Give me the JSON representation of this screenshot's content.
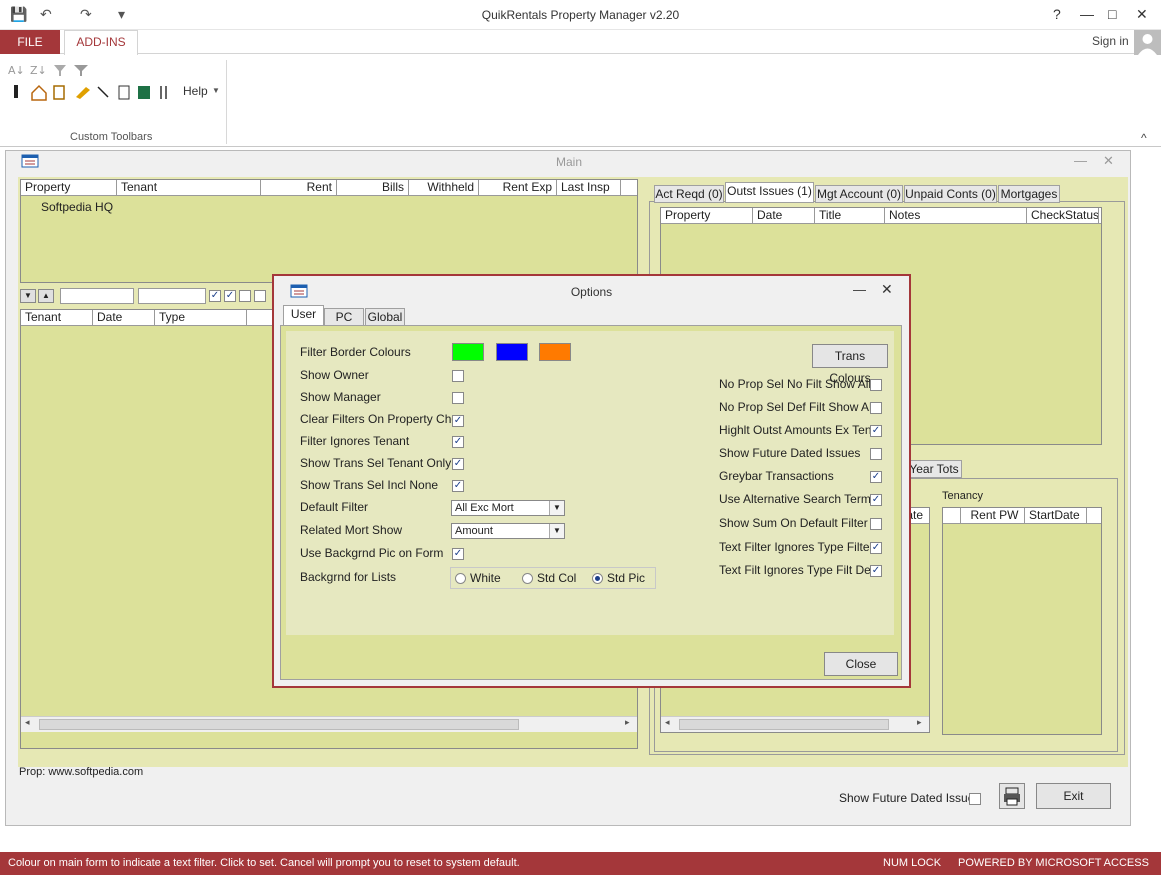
{
  "window": {
    "title": "QuikRentals Property Manager  v2.20",
    "help": "?",
    "min": "—",
    "max": "□",
    "close": "✕"
  },
  "quick_access": {
    "save": "💾",
    "undo": "↶",
    "redo": "↷",
    "more": "▾"
  },
  "ribbon": {
    "tabs": {
      "file": "FILE",
      "addins": "ADD-INS"
    },
    "signin": "Sign in",
    "help_label": "Help",
    "group_label": "Custom Toolbars",
    "collapse": "^"
  },
  "main": {
    "title": "Main",
    "property_list": {
      "headers": [
        "Property",
        "Tenant",
        "Rent",
        "Bills",
        "Withheld",
        "Rent Exp",
        "Last Insp"
      ],
      "rows": [
        [
          "Softpedia HQ",
          "",
          "",
          "",
          "",
          "",
          ""
        ]
      ]
    },
    "trans_list": {
      "headers": [
        "Tenant",
        "Date",
        "Type"
      ]
    },
    "prop_text": "Prop: www.softpedia.com",
    "right_tabs": [
      "Act Reqd (0)",
      "Outst Issues (1)",
      "Mgt Account (0)",
      "Unpaid Conts (0)",
      "Mortgages"
    ],
    "issues_headers": [
      "Property",
      "Date",
      "Title",
      "Notes",
      "CheckStatus"
    ],
    "lower_tab": "Year Tots",
    "tenancy_label": "Tenancy",
    "tenancy_headers": [
      "",
      "Rent PW",
      "StartDate"
    ],
    "left_partial_header": "ate",
    "show_future_label": "Show Future Dated Issues",
    "exit_label": "Exit"
  },
  "options": {
    "title": "Options",
    "tabs": [
      "User",
      "PC",
      "Global"
    ],
    "filter_border_colours": "Filter Border Colours",
    "colours": [
      "#00ff00",
      "#0000ff",
      "#ff7a00"
    ],
    "trans_colours": "Trans Colours",
    "left_settings": [
      {
        "label": "Show Owner",
        "checked": false
      },
      {
        "label": "Show Manager",
        "checked": false
      },
      {
        "label": "Clear Filters On Property Chg",
        "checked": true
      },
      {
        "label": "Filter Ignores Tenant",
        "checked": true
      },
      {
        "label": "Show Trans Sel Tenant Only",
        "checked": true
      },
      {
        "label": "Show Trans Sel Incl None",
        "checked": true
      }
    ],
    "default_filter": {
      "label": "Default Filter",
      "value": "All Exc Mort"
    },
    "related_mort": {
      "label": "Related Mort Show",
      "value": "Amount"
    },
    "backgrnd_pic": {
      "label": "Use Backgrnd Pic on Form",
      "checked": true
    },
    "backgrnd_lists": {
      "label": "Backgrnd for Lists",
      "options": [
        "White",
        "Std Col",
        "Std Pic"
      ],
      "selected": "Std Pic"
    },
    "right_settings": [
      {
        "label": "No Prop Sel No Filt Show All",
        "checked": false
      },
      {
        "label": "No Prop Sel Def Filt Show All",
        "checked": false
      },
      {
        "label": "Highlt Outst Amounts Ex Tens",
        "checked": true
      },
      {
        "label": "Show Future Dated Issues",
        "checked": false
      },
      {
        "label": "Greybar Transactions",
        "checked": true
      },
      {
        "label": "Use Alternative Search Terms",
        "checked": true
      },
      {
        "label": "Show Sum On Default Filter",
        "checked": false
      },
      {
        "label": "Text Filter Ignores Type Filter",
        "checked": true
      },
      {
        "label": "Text Filt Ignores Type Filt Def",
        "checked": true
      }
    ],
    "close_label": "Close"
  },
  "statusbar": {
    "message": "Colour on main form to indicate a text filter. Click to set. Cancel will prompt you to reset to system default.",
    "numlock": "NUM LOCK",
    "powered": "POWERED BY MICROSOFT ACCESS"
  }
}
